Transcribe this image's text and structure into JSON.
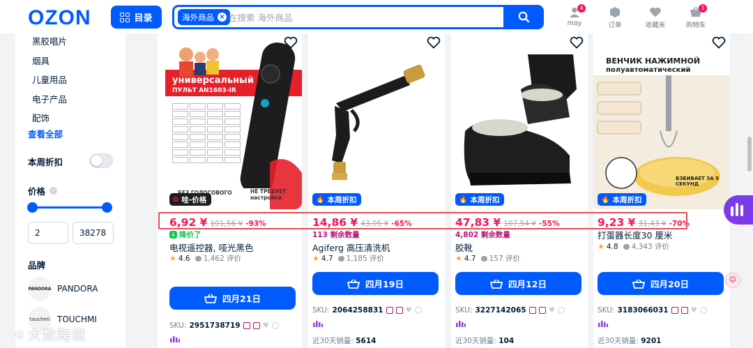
{
  "header": {
    "logo": "OZON",
    "catalog_label": "目录",
    "search_chip": "海外商品",
    "search_placeholder": "在搜索 海外商品",
    "user_label": "may",
    "user_badge": "4",
    "orders_label": "订单",
    "favorites_label": "收藏夹",
    "cart_label": "购物车",
    "cart_badge": "1"
  },
  "sidebar": {
    "categories": [
      "黑胶唱片",
      "烟具",
      "儿童用品",
      "电子产品",
      "配饰"
    ],
    "see_all": "查看全部",
    "weekly_discount": "本周折扣",
    "price_title": "价格",
    "price_min": "2",
    "price_max": "38278",
    "brand_title": "品牌",
    "brands": [
      {
        "name": "PANDORA",
        "logo": "PANDORA"
      },
      {
        "name": "TOUCHMI",
        "logo": "touchmi"
      }
    ]
  },
  "products": [
    {
      "badge": "哇-价格",
      "price": "6,92 ¥",
      "old_price": "101,56 ¥",
      "discount": "-93%",
      "note": "降价了",
      "name": "电视遥控器, 哑光黑色",
      "rating": "4.6",
      "reviews": "1,462 评价",
      "delivery": "四月21日",
      "sku_label": "SKU:",
      "sku": "2951738719",
      "image_text_1": "универсальный",
      "image_text_2": "ПУЛЬТ AN1603-IR",
      "image_text_3": "БЕЗ ГОЛОСОВОГО",
      "image_text_4": "НЕ ТРЕБУЕТ настройки"
    },
    {
      "badge": "本周折扣",
      "price": "14,86 ¥",
      "old_price": "43,05 ¥",
      "discount": "-65%",
      "note": "113 剩余数量",
      "name": "Agiferg 高压清洗机",
      "rating": "4.7",
      "reviews": "1,185 评价",
      "delivery": "四月19日",
      "sku_label": "SKU:",
      "sku": "2064258831",
      "sales_label": "近30天销量:",
      "sales": "5614"
    },
    {
      "badge": "本周折扣",
      "price": "47,83 ¥",
      "old_price": "107,54 ¥",
      "discount": "-55%",
      "note": "4,802 剩余数量",
      "name": "胶靴",
      "rating": "4.7",
      "reviews": "157 评价",
      "delivery": "四月12日",
      "sku_label": "SKU:",
      "sku": "3227142065",
      "sales_label": "近30天销量:",
      "sales": "104"
    },
    {
      "badge": "本周折扣",
      "price": "9,23 ¥",
      "old_price": "31,43 ¥",
      "discount": "-70%",
      "name": "打蛋器长度30 厘米",
      "rating": "4.8",
      "reviews": "4,343 评价",
      "delivery": "四月20日",
      "sku_label": "SKU:",
      "sku": "3183066031",
      "sales_label": "近30天销量:",
      "sales": "9201",
      "image_text_1": "ВЕНЧИК НАЖИМНОЙ",
      "image_text_2": "полуавтоматический",
      "image_text_3": "ВЗБИВАЕТ ЗА 5 СЕКУНД"
    }
  ],
  "watermark": "大数跨境",
  "colors": {
    "brand_blue": "#005bff",
    "price_pink": "#f91155",
    "highlight_red": "#e94a53"
  }
}
